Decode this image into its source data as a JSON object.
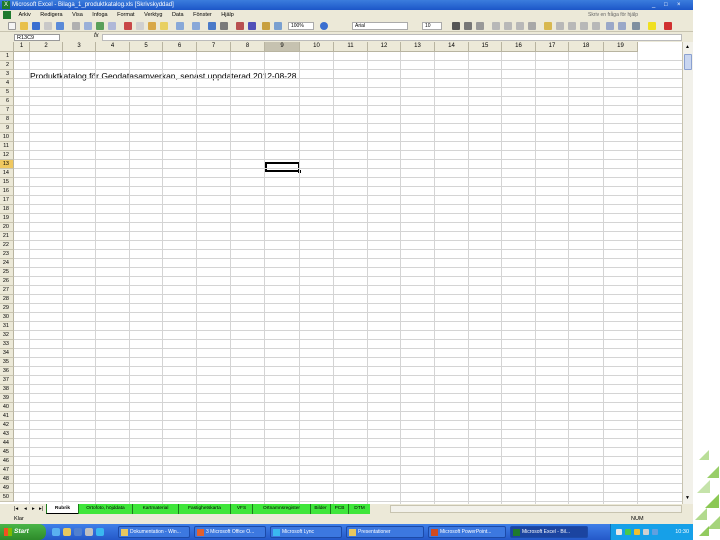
{
  "window": {
    "title": "Microsoft Excel - Bilaga_1_produktkatalog.xls [Skrivskyddad]",
    "controls": [
      "_",
      "□",
      "×"
    ]
  },
  "menu": {
    "items": [
      "Arkiv",
      "Redigera",
      "Visa",
      "Infoga",
      "Format",
      "Verktyg",
      "Data",
      "Fönster",
      "Hjälp"
    ],
    "help_placeholder": "Skriv en fråga för hjälp"
  },
  "toolbar": {
    "zoom": "100%",
    "font_name": "Arial",
    "font_size": "10"
  },
  "formula_bar": {
    "name_box": "R13C9",
    "fx": "fx",
    "content": ""
  },
  "sheet": {
    "columns": [
      "1",
      "2",
      "3",
      "4",
      "5",
      "6",
      "7",
      "8",
      "9",
      "10",
      "11",
      "12",
      "13",
      "14",
      "15",
      "16",
      "17",
      "18",
      "19"
    ],
    "selected_column": "9",
    "rows": [
      "1",
      "2",
      "3",
      "4",
      "5",
      "6",
      "7",
      "8",
      "9",
      "10",
      "11",
      "12",
      "13",
      "14",
      "15",
      "16",
      "17",
      "18",
      "19",
      "20",
      "21",
      "22",
      "23",
      "24",
      "25",
      "26",
      "27",
      "28",
      "29",
      "30",
      "31",
      "32",
      "33",
      "34",
      "35",
      "36",
      "37",
      "38",
      "39",
      "40",
      "41",
      "42",
      "43",
      "44",
      "45",
      "46",
      "47",
      "48",
      "49",
      "50"
    ],
    "selected_row": "13",
    "cell_text": "Produktkatalog för Geodatasamverkan, senast uppdaterad 2012-08-28"
  },
  "tabs": {
    "nav": [
      "|◂",
      "◂",
      "▸",
      "▸|"
    ],
    "sheets": [
      "Rubrik",
      "Ortofoto, höjddata",
      "Kartmaterial",
      "Fastighetskarta",
      "VFS",
      "Ortnamnsregister",
      "Bilder",
      "PCB",
      "DTM"
    ]
  },
  "status": {
    "ready": "Klar",
    "num": "NUM"
  },
  "taskbar": {
    "start": "Start",
    "tasks": [
      "Dokumentation - Win...",
      "3 Microsoft Office O...",
      "Microsoft Lync",
      "Presentationer",
      "Microsoft PowerPoint...",
      "Microsoft Excel - Bil..."
    ],
    "clock": "10:30"
  },
  "colors": {
    "tab_green": "#3fe63a",
    "titlebar_blue": "#1c56c8",
    "taskbar_blue": "#2458c8",
    "start_green": "#2d8a2a",
    "deco_green": "#7fc243"
  }
}
